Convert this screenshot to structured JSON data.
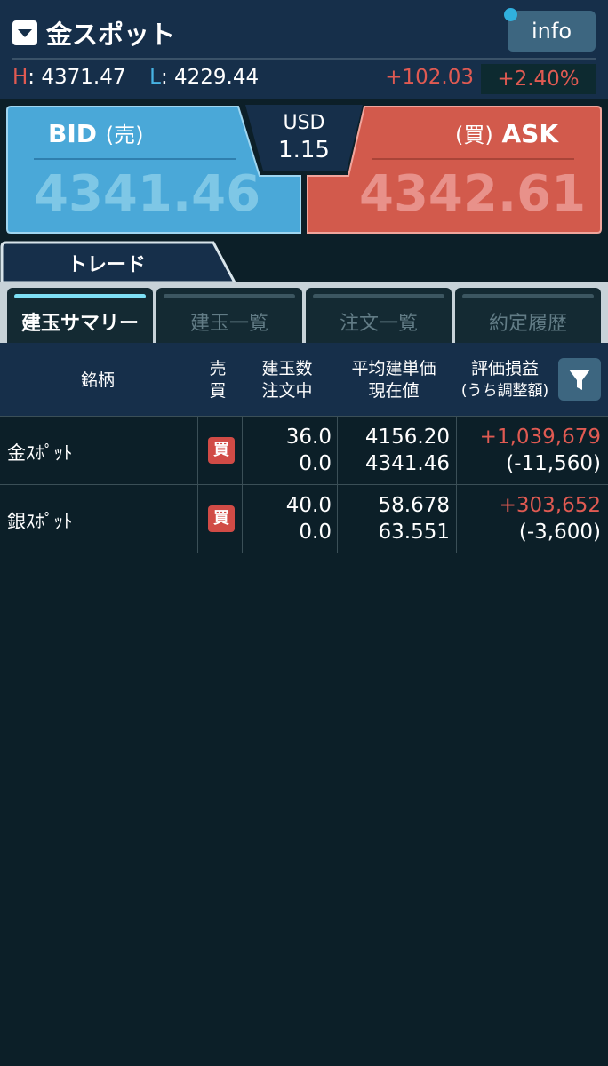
{
  "header": {
    "title": "金スポット",
    "info_label": "info",
    "high_label": "H",
    "high_value": "4371.47",
    "low_label": "L",
    "low_value": "4229.44",
    "change": "+102.03",
    "change_pct": "+2.40%"
  },
  "quote": {
    "bid": {
      "label": "BID",
      "paren": "(売)",
      "price": "4341.46"
    },
    "ask": {
      "label": "ASK",
      "paren": "(買)",
      "price": "4342.61"
    },
    "spread_currency": "USD",
    "spread_value": "1.15"
  },
  "trade_tab": {
    "label": "トレード"
  },
  "subtabs": [
    {
      "label": "建玉サマリー",
      "active": true
    },
    {
      "label": "建玉一覧",
      "active": false
    },
    {
      "label": "注文一覧",
      "active": false
    },
    {
      "label": "約定履歴",
      "active": false
    }
  ],
  "table": {
    "headers": {
      "symbol": "銘柄",
      "side_1": "売",
      "side_2": "買",
      "qty_1": "建玉数",
      "qty_2": "注文中",
      "price_1": "平均建単価",
      "price_2": "現在値",
      "pl_1": "評価損益",
      "pl_2": "(うち調整額)"
    },
    "rows": [
      {
        "symbol": "金ｽﾎﾟｯﾄ",
        "side": "買",
        "qty": "36.0",
        "ordering": "0.0",
        "avg_price": "4156.20",
        "current_price": "4341.46",
        "pl": "+1,039,679",
        "adjust": "(-11,560)"
      },
      {
        "symbol": "銀ｽﾎﾟｯﾄ",
        "side": "買",
        "qty": "40.0",
        "ordering": "0.0",
        "avg_price": "58.678",
        "current_price": "63.551",
        "pl": "+303,652",
        "adjust": "(-3,600)"
      }
    ]
  },
  "colors": {
    "bid_blue": "#4aa8d8",
    "ask_red": "#d25a4c",
    "positive_red": "#e05a52",
    "accent_cyan": "#7ee0f5"
  },
  "icons": {
    "dropdown": "caret-down-icon",
    "filter": "funnel-icon"
  }
}
